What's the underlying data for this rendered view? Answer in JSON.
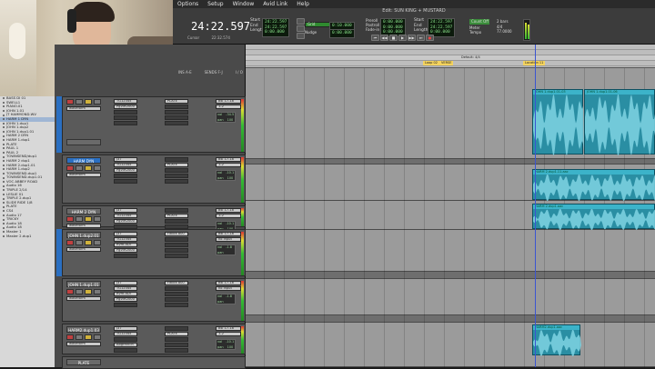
{
  "menubar": {
    "items": [
      "Options",
      "Setup",
      "Window",
      "Avid Link",
      "Help"
    ]
  },
  "window_title": "Edit: SUN KING + MUSTARD",
  "transport": {
    "main_counter": "24:22.597",
    "start": "24:22.597",
    "end": "24:22.597",
    "length": "0:00.000",
    "start_label": "Start",
    "end_label": "End",
    "length_label": "Length",
    "grid_label": "Grid",
    "grid_value": "0:10.000",
    "nudge_label": "Nudge",
    "nudge_value": "0:00.000",
    "cursor_label": "Cursor",
    "cursor_value": "22:32.574",
    "pre_label": "Preroll",
    "pre_value": "0:00.000",
    "post_label": "Postroll",
    "post_value": "0:00.000",
    "fadein_label": "Fade-in",
    "fadein_value": "0:00.000",
    "meter_label": "Meter",
    "meter_value": "4/4",
    "tempo_label": "Tempo",
    "tempo_value": "77.0000",
    "count_label": "2 bars",
    "buttons": [
      "⏮",
      "◀◀",
      "■",
      "▶",
      "▶▶",
      "⏭",
      "●"
    ]
  },
  "mixer_header": [
    "INS A-E",
    "SENDS F-J",
    "I / O"
  ],
  "tracklist": [
    "BASS DI 01",
    "SWELL1",
    "PIANO.01",
    "JOHN 1.01",
    "JT HAMMOND.WV",
    "HARM 1 DYN",
    "JOHN 1.dup1",
    "JOHN 1.dup2",
    "JOHN 1.dup1.01",
    "HARM 2 DYN",
    "HARM 1.dup1",
    "PLATE",
    "PAUL 1",
    "PAUL 2",
    "TOWNSEND/dup1",
    "HARM 2 dup1",
    "HARM 2.dup1.01",
    "HARM 1.dup2",
    "TOWNSEND.dup1",
    "TOWNSEND.dup1.01",
    "VOC ABBEY ROAD",
    "Audio 16",
    "TRIPLE 2/14",
    "LESLIE 01",
    "TRIPLE 2.dup1",
    "SLIDE RIDE 1/8",
    "PLATE",
    "CS4",
    "Audio 17",
    "TRICKY",
    "Audio 18",
    "Audio 18",
    "Master 1",
    "Master 2.dup1"
  ],
  "strips": [
    {
      "name": "",
      "inserts": [
        "TG12345",
        "PgVirt2000"
      ],
      "sends": [
        "PLATE",
        "",
        "",
        ""
      ],
      "io_in": "Bsl 17-18",
      "io_out": "1-2",
      "vol": "-34.5",
      "pan": "100",
      "name_blue": false
    },
    {
      "name": "HARM DYN",
      "inserts": [
        "J37",
        "TG12345",
        "PgVirt2000"
      ],
      "sends": [
        "",
        "PLATE",
        "",
        ""
      ],
      "io_in": "Bsl 17-18",
      "io_out": "1-2",
      "vol": "-10.1",
      "pan": "100",
      "name_blue": true
    },
    {
      "name": "HARM 2 DYN",
      "inserts": [
        "J37",
        "TG12345",
        "PgVirt2000"
      ],
      "sends": [
        "",
        "PLATE",
        "",
        ""
      ],
      "io_in": "Bsl 17-18",
      "io_out": "1-2",
      "vol": "-10.1",
      "pan": "100",
      "name_blue": false
    },
    {
      "name": "JOHN 1.dup2.01",
      "inserts": [
        "J37",
        "TG12345",
        "Rvrb ADT",
        "PgVirt2000"
      ],
      "sends": [
        "Fdbck 800",
        "",
        "",
        ""
      ],
      "io_in": "Bsl 17-18",
      "io_out": "no input",
      "vol": "-1.8",
      "pan": "",
      "name_blue": false
    },
    {
      "name": "JOHN 1.dup1.01",
      "inserts": [
        "J37",
        "TG12345",
        "Rvrb ADT",
        "PgVirt2000"
      ],
      "sends": [
        "Fdbck 800",
        "",
        "",
        ""
      ],
      "io_in": "Bsl 17-18",
      "io_out": "no input",
      "vol": "-1.8",
      "pan": "",
      "name_blue": false
    },
    {
      "name": "HARM2.dup1.03",
      "inserts": [
        "J37",
        "TG12345",
        "",
        "AbgrRVEin"
      ],
      "sends": [
        "",
        "PLATE",
        "",
        ""
      ],
      "io_in": "Bsl 17-18",
      "io_out": "1-2",
      "vol": "-10.1",
      "pan": "100",
      "name_blue": false
    },
    {
      "name": "PLATE",
      "inserts": [],
      "sends": [],
      "io_in": "",
      "io_out": "",
      "vol": "",
      "pan": "",
      "name_blue": false
    }
  ],
  "strip_labels": {
    "vol": "vol",
    "pan": "pan",
    "waveform": "waveform",
    "volume": "volume"
  },
  "ruler": {
    "marker_default": "Default: 4/4",
    "markers": [
      "Loop 02",
      "VERSE",
      "Location 11"
    ]
  },
  "clips": [
    {
      "label": "JOHN 1.dup1.01-03",
      "lane": 0
    },
    {
      "label": "JOHN 1.dup1.01-06",
      "lane": 0
    },
    {
      "label": "HARM 2.dup1.11.aac",
      "lane": 1
    },
    {
      "label": "HARM 2.dup1.aac",
      "lane": 2
    },
    {
      "label": "HARM2.dup1.aac",
      "lane": 5
    }
  ],
  "colors": {
    "clip": "#2a8ea3",
    "selected_track": "#2a6fc2",
    "record": "#e44444",
    "counter_green": "#88e088"
  }
}
